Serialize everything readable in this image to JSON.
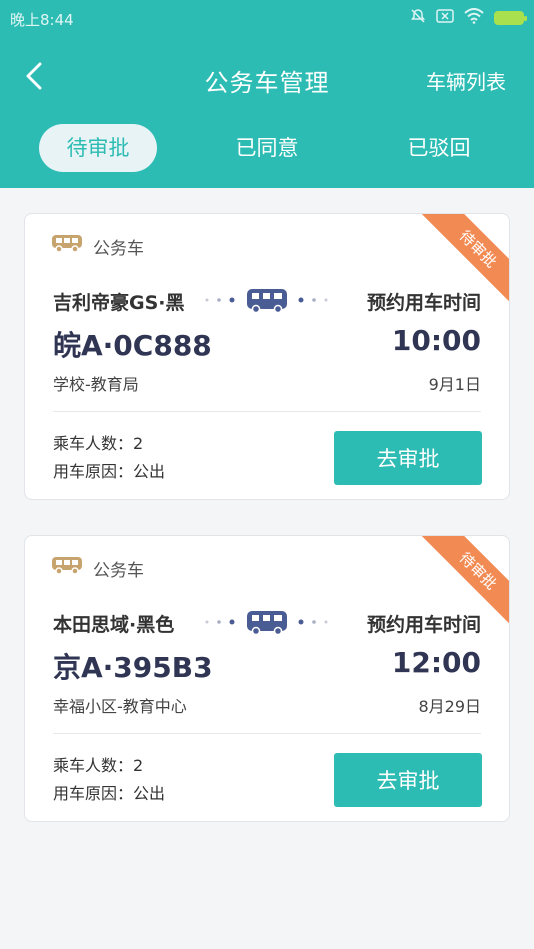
{
  "status_bar": {
    "time": "晚上8:44"
  },
  "nav": {
    "title": "公务车管理",
    "right_action": "车辆列表"
  },
  "tabs": [
    {
      "label": "待审批",
      "active": true
    },
    {
      "label": "已同意",
      "active": false
    },
    {
      "label": "已驳回",
      "active": false
    }
  ],
  "colors": {
    "primary": "#2cbcb3",
    "ribbon": "#f28b53",
    "plate_text": "#2f3553",
    "car_icon": "#c7a46d",
    "bus_icon": "#4a5c94"
  },
  "cards": [
    {
      "status_ribbon": "待审批",
      "car_type": "公务车",
      "model": "吉利帝豪GS·黑",
      "time_label": "预约用车时间",
      "plate": "皖A·0C888",
      "time": "10:00",
      "route": "学校-教育局",
      "date": "9月1日",
      "passengers": "乘车人数：2",
      "reason": "用车原因：公出",
      "action_label": "去审批"
    },
    {
      "status_ribbon": "待审批",
      "car_type": "公务车",
      "model": "本田思域·黑色",
      "time_label": "预约用车时间",
      "plate": "京A·395B3",
      "time": "12:00",
      "route": "幸福小区-教育中心",
      "date": "8月29日",
      "passengers": "乘车人数：2",
      "reason": "用车原因：公出",
      "action_label": "去审批"
    }
  ]
}
